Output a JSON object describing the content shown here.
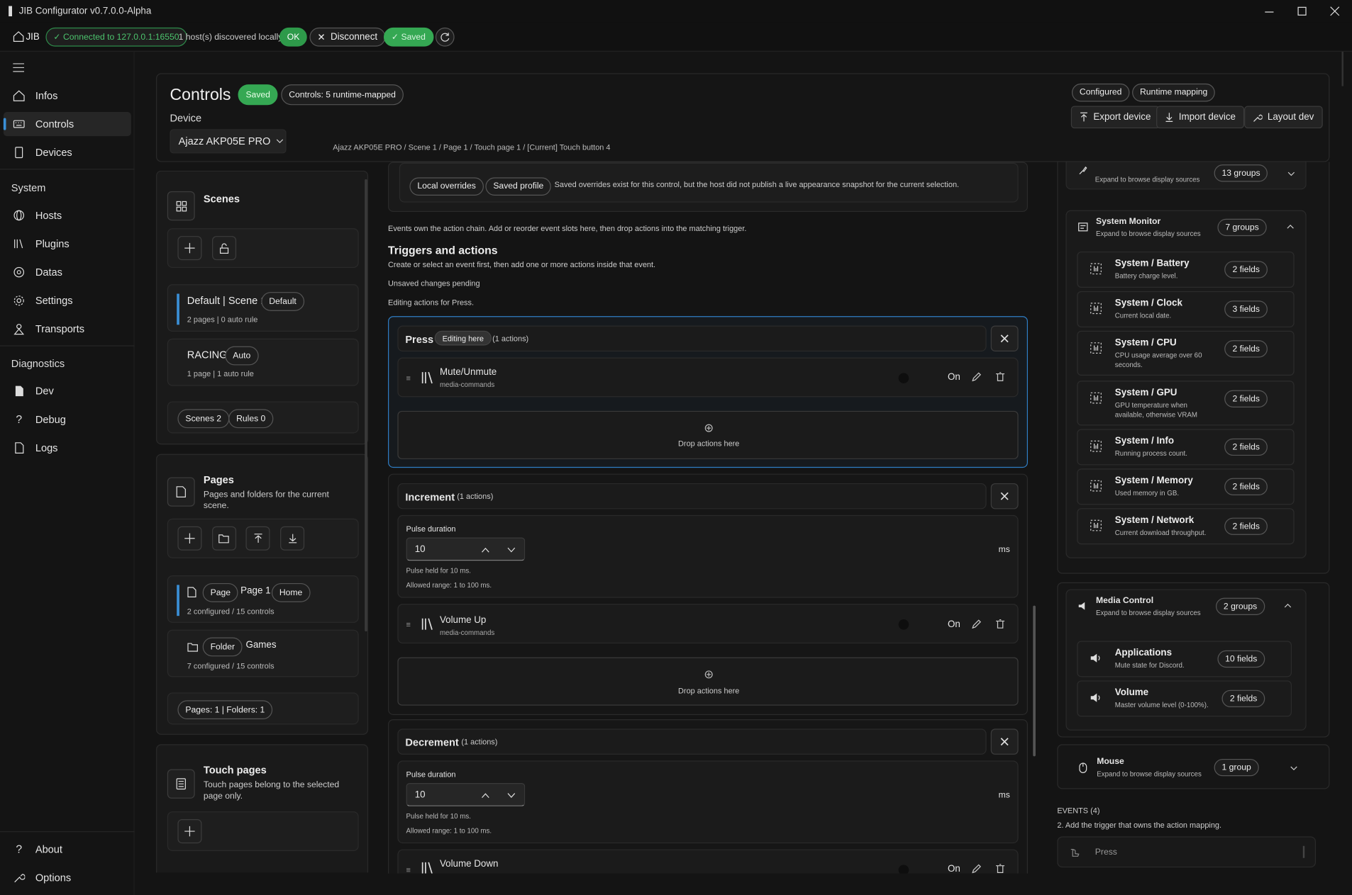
{
  "window": {
    "title": "JIB Configurator v0.7.0.0-Alpha"
  },
  "toolbar": {
    "brand": "JIB",
    "connection": "Connected to 127.0.0.1:16550",
    "hosts": "1 host(s) discovered locally.",
    "ok": "OK",
    "disconnect": "Disconnect",
    "saved": "Saved"
  },
  "nav": {
    "items": [
      "Infos",
      "Controls",
      "Devices"
    ],
    "system_header": "System",
    "system_items": [
      "Hosts",
      "Plugins",
      "Datas",
      "Settings",
      "Transports"
    ],
    "diag_header": "Diagnostics",
    "diag_items": [
      "Dev",
      "Debug",
      "Logs"
    ],
    "bottom_items": [
      "About",
      "Options"
    ]
  },
  "header": {
    "title": "Controls",
    "saved_badge": "Saved",
    "count_badge": "Controls: 5 runtime-mapped",
    "device_label": "Device",
    "device_value": "Ajazz AKP05E PRO",
    "breadcrumb": "Ajazz AKP05E PRO / Scene 1 / Page 1 / Touch page 1 / [Current] Touch button 4",
    "configured": "Configured",
    "runtime_mapping": "Runtime mapping",
    "export": "Export device",
    "import": "Import device",
    "layout": "Layout dev"
  },
  "scenes": {
    "title": "Scenes",
    "items": [
      {
        "name": "Default | Scene 1",
        "badge": "Default",
        "meta": "2 pages | 0 auto rule"
      },
      {
        "name": "RACING",
        "badge": "Auto",
        "meta": "1 page | 1 auto rule"
      }
    ],
    "footer": [
      "Scenes 2",
      "Rules 0"
    ]
  },
  "pages": {
    "title": "Pages",
    "desc": "Pages and folders for the current scene.",
    "items": [
      {
        "kind": "Page",
        "name": "Page 1",
        "badge": "Home",
        "meta": "2 configured / 15 controls"
      },
      {
        "kind": "Folder",
        "name": "Games",
        "meta": "7 configured / 15 controls"
      }
    ],
    "footer": "Pages: 1 | Folders: 1"
  },
  "touch": {
    "title": "Touch pages",
    "desc": "Touch pages belong to the selected page only."
  },
  "center": {
    "local_overrides": "Local overrides",
    "saved_profile": "Saved profile",
    "overrides_note": "Saved overrides exist for this control, but the host did not publish a live appearance snapshot for the current selection.",
    "events_note": "Events own the action chain. Add or reorder event slots here, then drop actions into the matching trigger.",
    "section_title": "Triggers and actions",
    "section_desc": "Create or select an event first, then add one or more actions inside that event.",
    "unsaved": "Unsaved changes pending",
    "editing_for": "Editing actions for Press.",
    "drop": "Drop actions here",
    "on": "On",
    "ms": "ms",
    "press": {
      "name": "Press",
      "badge": "Editing here",
      "count": "(1 actions)",
      "action": "Mute/Unmute",
      "plugin": "media-commands"
    },
    "increment": {
      "name": "Increment",
      "count": "(1 actions)",
      "pulse_label": "Pulse duration",
      "pulse_value": "10",
      "held": "Pulse held for 10 ms.",
      "range": "Allowed range: 1 to 100 ms.",
      "action": "Volume Up",
      "plugin": "media-commands"
    },
    "decrement": {
      "name": "Decrement",
      "count": "(1 actions)",
      "pulse_label": "Pulse duration",
      "pulse_value": "10",
      "held": "Pulse held for 10 ms.",
      "range": "Allowed range: 1 to 100 ms.",
      "action": "Volume Down"
    }
  },
  "right": {
    "top_group": {
      "desc": "Expand to browse display sources",
      "badge": "13 groups"
    },
    "system_monitor": {
      "name": "System Monitor",
      "desc": "Expand to browse display sources",
      "badge": "7 groups",
      "items": [
        {
          "t": "System / Battery",
          "d": "Battery charge level.",
          "f": "2 fields"
        },
        {
          "t": "System / Clock",
          "d": "Current local date.",
          "f": "3 fields"
        },
        {
          "t": "System / CPU",
          "d": "CPU usage average over 60 seconds.",
          "f": "2 fields"
        },
        {
          "t": "System / GPU",
          "d": "GPU temperature when available, otherwise VRAM",
          "f": "2 fields"
        },
        {
          "t": "System / Info",
          "d": "Running process count.",
          "f": "2 fields"
        },
        {
          "t": "System / Memory",
          "d": "Used memory in GB.",
          "f": "2 fields"
        },
        {
          "t": "System / Network",
          "d": "Current download throughput.",
          "f": "2 fields"
        }
      ]
    },
    "media": {
      "name": "Media Control",
      "desc": "Expand to browse display sources",
      "badge": "2 groups",
      "items": [
        {
          "t": "Applications",
          "d": "Mute state for Discord.",
          "f": "10 fields"
        },
        {
          "t": "Volume",
          "d": "Master volume level (0-100%).",
          "f": "2 fields"
        }
      ]
    },
    "mouse": {
      "name": "Mouse",
      "desc": "Expand to browse display sources",
      "badge": "1 group"
    },
    "events_header": "EVENTS (4)",
    "events_step": "2. Add the trigger that owns the action mapping.",
    "event_press": "Press"
  }
}
